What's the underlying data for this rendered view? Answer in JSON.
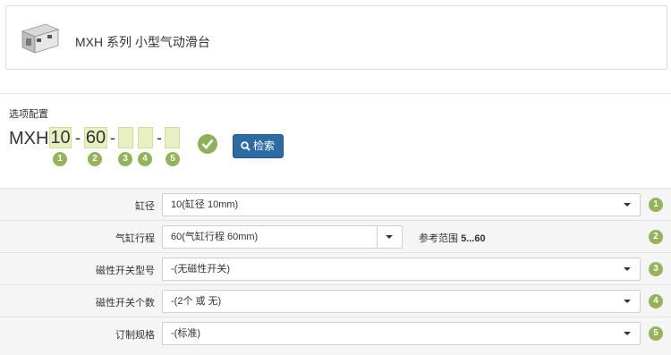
{
  "header": {
    "title": "MXH 系列 小型气动滑台"
  },
  "config": {
    "label": "选项配置",
    "prefix": "MXH",
    "segments": [
      "10",
      "60",
      "",
      "",
      ""
    ],
    "dash": "-",
    "badges": [
      "1",
      "2",
      "3",
      "4",
      "5"
    ],
    "search_label": "检索"
  },
  "rows": [
    {
      "label": "缸径",
      "value": "10(缸径 10mm)",
      "badge": "1"
    },
    {
      "label": "气缸行程",
      "value": "60(气缸行程 60mm)",
      "range_label": "参考范围",
      "range_value": "5...60",
      "badge": "2"
    },
    {
      "label": "磁性开关型号",
      "value": "-(无磁性开关)",
      "badge": "3"
    },
    {
      "label": "磁性开关个数",
      "value": "-(2个 或 无)",
      "badge": "4"
    },
    {
      "label": "订制规格",
      "value": "-(标准)",
      "badge": "5"
    }
  ],
  "colors": {
    "badge": "#95b35a",
    "code_box": "#e7f0c2",
    "search_button": "#2d6ca2",
    "row_bg": "#f5f5f5"
  }
}
